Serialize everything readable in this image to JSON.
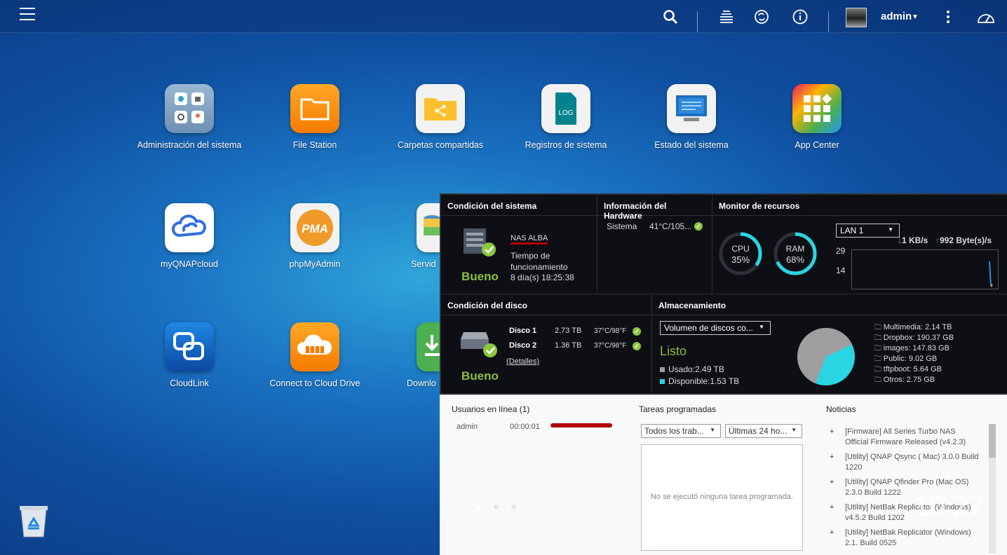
{
  "topbar": {
    "user": "admin"
  },
  "apps": [
    {
      "label": "Administración del sistema"
    },
    {
      "label": "File Station"
    },
    {
      "label": "Carpetas compartidas"
    },
    {
      "label": "Registros de sistema"
    },
    {
      "label": "Estado del sistema"
    },
    {
      "label": "App Center"
    },
    {
      "label": "myQNAPcloud"
    },
    {
      "label": "phpMyAdmin"
    },
    {
      "label": "Servid"
    },
    {
      "label": "CloudLink"
    },
    {
      "label": "Connect to Cloud Drive"
    },
    {
      "label": "Downlo"
    }
  ],
  "app_icons": {
    "log_text": "LOG",
    "pma_text": "PMA"
  },
  "system": {
    "header": "Condición del sistema",
    "nas_name": "NAS ALBA",
    "uptime_label": "Tiempo de funcionamiento",
    "uptime_value": "8 día(s) 18:25:38",
    "status": "Bueno"
  },
  "hardware": {
    "header": "Información del Hardware",
    "label": "Sistema",
    "value": "41°C/105..."
  },
  "monitor": {
    "header": "Monitor de recursos",
    "cpu_label": "CPU",
    "cpu_value": "35%",
    "cpu_pct": 35,
    "ram_label": "RAM",
    "ram_value": "68%",
    "ram_pct": 68,
    "lan": "LAN 1",
    "download": "1 KB/s",
    "upload": "992 Byte(s)/s",
    "y_top": "29",
    "y_mid": "14"
  },
  "disk": {
    "header": "Condición del disco",
    "disks": [
      {
        "name": "Disco 1",
        "size": "2.73 TB",
        "temp": "37°C/98°F"
      },
      {
        "name": "Disco 2",
        "size": "1.36 TB",
        "temp": "37°C/98°F"
      }
    ],
    "details": "(Detalles)",
    "status": "Bueno"
  },
  "storage": {
    "header": "Almacenamiento",
    "volume": "Volumen de discos co...",
    "status": "Listo",
    "used": "Usado:2.49 TB",
    "available": "Disponible:1.53 TB",
    "used_fraction": 0.62,
    "folders": [
      "Multimedia: 2.14 TB",
      "Dropbox: 190.37 GB",
      "images: 147.83 GB",
      "Public: 9.02 GB",
      "tftpboot: 5.64 GB",
      "Otros: 2.75 GB"
    ]
  },
  "online": {
    "header": "Usuarios en línea (1)",
    "user": "admin",
    "time": "00:00:01"
  },
  "tasks": {
    "header": "Tareas programadas",
    "filter1": "Todos los trab...",
    "filter2": "Últimas 24 ho...",
    "empty": "No se ejecutó ninguna tarea programada."
  },
  "news": {
    "header": "Noticias",
    "items": [
      "[Firmware] All Series Turbo NAS Official Firmware Released (v4.2.3)",
      "[Utility] QNAP Qsync ( Mac) 3.0.0 Build 1220",
      "[Utility] QNAP Qfinder Pro (Mac OS) 2.3.0 Build 1222",
      "[Utility] NetBak Replicator (Windows) v4.5.2 Build 1202",
      "[Utility] NetBak Replicator (Windows) 2.1. Build 0525"
    ]
  },
  "clock": "10:27",
  "colors": {
    "accent_cyan": "#29d5e3",
    "good_green": "#8cbf3f",
    "pie_used": "#9e9e9e"
  }
}
